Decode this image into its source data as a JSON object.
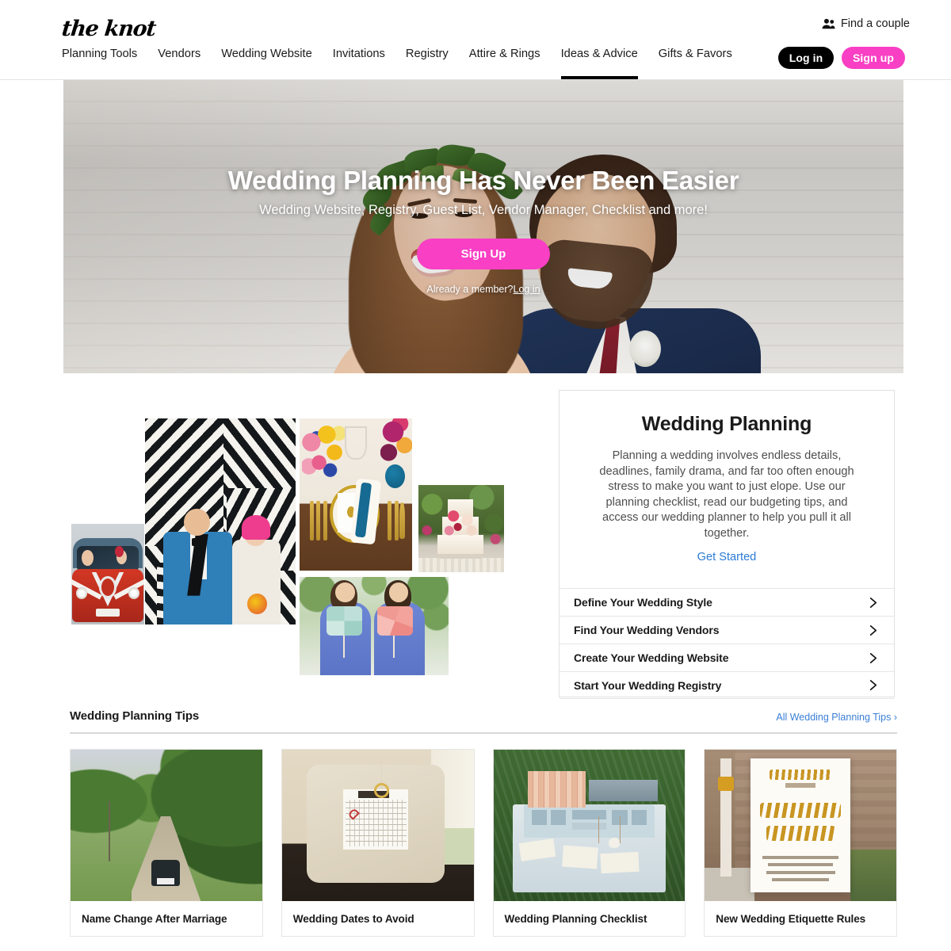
{
  "header": {
    "logo": "the knot",
    "find_couple": "Find a couple",
    "find_couple_icon": "people-icon",
    "nav_items": [
      {
        "label": "Planning Tools",
        "active": false
      },
      {
        "label": "Vendors",
        "active": false
      },
      {
        "label": "Wedding Website",
        "active": false
      },
      {
        "label": "Invitations",
        "active": false
      },
      {
        "label": "Registry",
        "active": false
      },
      {
        "label": "Attire & Rings",
        "active": false
      },
      {
        "label": "Ideas & Advice",
        "active": true
      },
      {
        "label": "Gifts & Favors",
        "active": false
      }
    ],
    "login_label": "Log in",
    "signup_label": "Sign up"
  },
  "hero": {
    "heading": "Wedding Planning Has Never Been Easier",
    "subheading": "Wedding Website, Registry, Guest List, Vendor Manager, Checklist and more!",
    "cta_label": "Sign Up",
    "member_prefix": "Already a member?",
    "member_link": "Log in"
  },
  "collage": {
    "photos": [
      {
        "name": "vw-van-wedding-car",
        "alt": "Couple in red VW camper van decorated with ribbons"
      },
      {
        "name": "chevron-backdrop-couple",
        "alt": "Couple in front of black and white chevron backdrop"
      },
      {
        "name": "tablescape-place-setting",
        "alt": "Gold flatware place setting with blue napkin and flowers"
      },
      {
        "name": "naked-wedding-cake",
        "alt": "Three tier naked cake with pink and white flowers"
      },
      {
        "name": "bridesmaids-pinwheels",
        "alt": "Two bridesmaids in blue dresses holding pinwheels"
      }
    ]
  },
  "wedding_planning": {
    "title": "Wedding Planning",
    "body": "Planning a wedding involves endless details, deadlines, family drama, and far too often enough stress to make you want to just elope. Use our planning checklist, read our budgeting tips, and access our wedding planner to help you pull it all together.",
    "link_label": "Get Started",
    "link_color": "#2b7bd4",
    "rows": [
      {
        "label": "Define Your Wedding Style"
      },
      {
        "label": "Find Your Wedding Vendors"
      },
      {
        "label": "Create Your Wedding Website"
      },
      {
        "label": "Start Your Wedding Registry"
      }
    ]
  },
  "tips": {
    "section_title": "Wedding Planning Tips",
    "all_link": "All Wedding Planning Tips ›",
    "cards": [
      {
        "title": "Name Change After Marriage",
        "image": "country-road-vintage-car"
      },
      {
        "title": "Wedding Dates to Avoid",
        "image": "ring-pillow-calendar"
      },
      {
        "title": "Wedding Planning Checklist",
        "image": "vintage-desk-programs"
      },
      {
        "title": "New Wedding Etiquette Rules",
        "image": "unplugged-wedding-sign"
      }
    ]
  },
  "colors": {
    "brand_pink": "#f93fc4",
    "link_blue": "#2b7bd4",
    "black": "#000000"
  }
}
